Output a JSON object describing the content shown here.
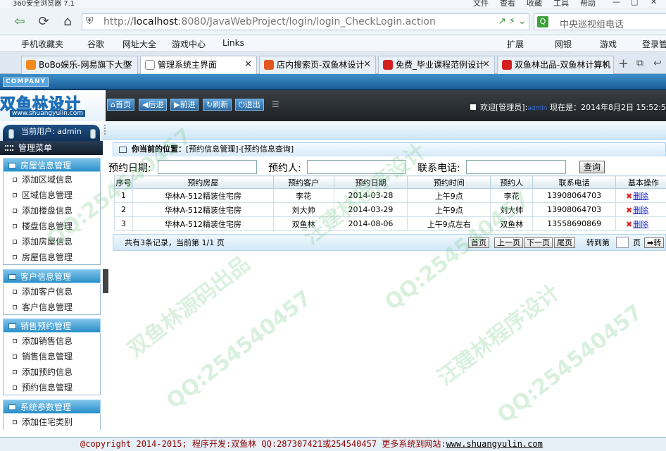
{
  "browser": {
    "window_title": "360安全浏览器 7.1",
    "menu": [
      "文件",
      "查看",
      "收藏",
      "工具",
      "帮助"
    ],
    "url": {
      "prefix": "http://",
      "host": "localhost",
      "rest": ":8080/JavaWebProject/login/login_CheckLogin.action"
    },
    "search_placeholder": "中央巡视组电话",
    "favorites": [
      "手机收藏夹",
      "谷歌",
      "网址大全",
      "游戏中心",
      "Links",
      "扩展",
      "网银",
      "游戏",
      "登录管"
    ],
    "tabs": [
      {
        "label": "BoBo娱乐-网易旗下大型",
        "color": "#f08a1c"
      },
      {
        "label": "管理系统主界面",
        "color": "#ffffff"
      },
      {
        "label": "店内搜索页-双鱼林设计",
        "color": "#e2571e"
      },
      {
        "label": "免费_毕业课程范例设计",
        "color": "#d42020"
      },
      {
        "label": "双鱼林出品-双鱼林计算机",
        "color": "#d42020"
      }
    ]
  },
  "app": {
    "company_label": "COMPANY",
    "logo_cn": "双鱼林设计",
    "logo_en": "www.shuangyulin.com",
    "toolbar": [
      "首页",
      "后退",
      "前进",
      "刷新",
      "退出"
    ],
    "welcome": {
      "prefix": "欢迎[管理员]:",
      "user": "admin",
      "now_label": "现在是：",
      "datetime": "2014年8月2日 15:52:5"
    }
  },
  "sidebar": {
    "current_user": "当前用户: admin",
    "menu_title": "管理菜单",
    "groups": [
      {
        "title": "房屋信息管理",
        "items": [
          "添加区域信息",
          "区域信息管理",
          "添加楼盘信息",
          "楼盘信息管理",
          "添加房屋信息",
          "房屋信息管理"
        ]
      },
      {
        "title": "客户信息管理",
        "items": [
          "添加客户信息",
          "客户信息管理"
        ]
      },
      {
        "title": "销售预约管理",
        "items": [
          "添加销售信息",
          "销售信息管理",
          "添加预约信息",
          "预约信息管理"
        ]
      },
      {
        "title": "系统参数管理",
        "items": [
          "添加住宅类别"
        ]
      }
    ]
  },
  "main": {
    "breadcrumb_label": "你当前的位置：",
    "breadcrumb_path": "[预约信息管理]-[预约信息查询]",
    "query": {
      "date_label": "预约日期:",
      "person_label": "预约人:",
      "phone_label": "联系电话:",
      "button": "查询"
    },
    "columns": [
      "序号",
      "预约房屋",
      "预约客户",
      "预约日期",
      "预约时间",
      "预约人",
      "联系电话",
      "基本操作"
    ],
    "rows": [
      [
        "1",
        "华林A-512精装住宅房",
        "李花",
        "2014-03-28",
        "上午9点",
        "李花",
        "13908064703",
        "删除"
      ],
      [
        "2",
        "华林A-512精装住宅房",
        "刘大帅",
        "2014-03-29",
        "上午9点",
        "刘大帅",
        "13908064703",
        "删除"
      ],
      [
        "3",
        "华林A-512精装住宅房",
        "双鱼林",
        "2014-08-06",
        "上午9点左右",
        "双鱼林",
        "13558690869",
        "删除"
      ]
    ],
    "pager": {
      "info": "共有3条记录，当前第 1/1 页",
      "first": "首页",
      "prev": "上一页",
      "next": "下一页",
      "last": "尾页",
      "goto": "转到第",
      "page_unit": "页",
      "go": "➡转"
    }
  },
  "footer": {
    "text": "@copyright 2014-2015; 程序开发:双鱼林  QQ:287307421或254540457  更多系统到网站:",
    "link": "www.shuangyulin.com"
  },
  "watermarks": [
    "QQ:254540457",
    "汪建林程序设计",
    "双鱼林源码出品"
  ]
}
